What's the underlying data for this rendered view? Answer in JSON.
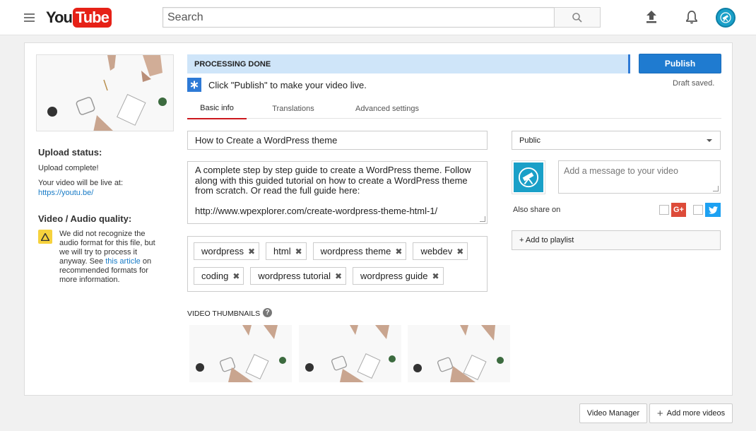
{
  "header": {
    "logo_you": "You",
    "logo_tube": "Tube",
    "search_placeholder": "Search",
    "icons": [
      "menu-icon",
      "search-icon",
      "upload-icon",
      "bell-icon",
      "avatar"
    ]
  },
  "upload": {
    "processing_status": "PROCESSING DONE",
    "publish_label": "Publish",
    "draft_status": "Draft saved.",
    "publish_hint": "Click \"Publish\" to make your video live."
  },
  "tabs": [
    {
      "label": "Basic info",
      "active": true
    },
    {
      "label": "Translations",
      "active": false
    },
    {
      "label": "Advanced settings",
      "active": false
    }
  ],
  "left": {
    "upload_status_title": "Upload status:",
    "upload_complete": "Upload complete!",
    "live_at_label": "Your video will be live at:",
    "video_url": "https://youtu.be/",
    "quality_title": "Video / Audio quality:",
    "warning_pre": "We did not recognize the audio format for this file, but we will try to process it anyway. See ",
    "warning_link": "this article",
    "warning_post": " on recommended formats for more information."
  },
  "form": {
    "title": "How to Create a WordPress theme",
    "description_lines": [
      "A complete step by step guide to create a WordPress theme. Follow along with this guided tutorial on how to create a WordPress theme from scratch. Or read the full guide here:",
      "http://www.wpexplorer.com/create-wordpress-theme-html-1/"
    ],
    "tags": [
      "wordpress",
      "html",
      "wordpress theme",
      "webdev",
      "coding",
      "wordpress tutorial",
      "wordpress guide"
    ],
    "tag_remove_glyph": "✖",
    "thumbnails_label": "VIDEO THUMBNAILS",
    "help_glyph": "?"
  },
  "right": {
    "privacy": "Public",
    "message_placeholder": "Add a message to your video",
    "share_label": "Also share on",
    "gplus_label": "G+",
    "playlist_label": "+ Add to playlist"
  },
  "footer": {
    "video_manager": "Video Manager",
    "add_more": "Add more videos",
    "add_more_glyph": "+"
  },
  "colors": {
    "brand_red": "#e62117",
    "publish_blue": "#1f7bd0",
    "processing_bg": "#cfe5f9",
    "tab_active": "#cc181e",
    "link": "#167ac6",
    "warning": "#f6d23d"
  }
}
